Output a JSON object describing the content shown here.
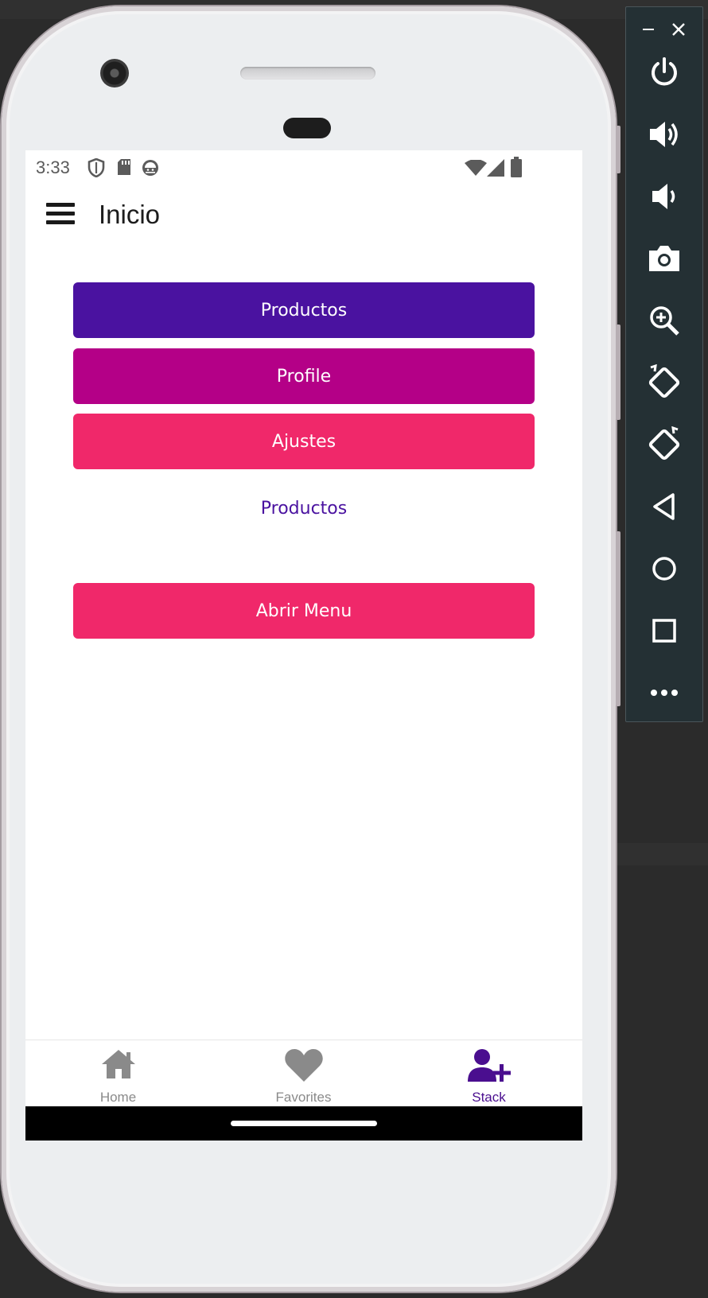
{
  "status_bar": {
    "time": "3:33"
  },
  "app_bar": {
    "title": "Inicio"
  },
  "buttons": {
    "productos": "Productos",
    "profile": "Profile",
    "ajustes": "Ajustes",
    "productos_link": "Productos",
    "abrir_menu": "Abrir Menu"
  },
  "tabs": [
    {
      "label": "Home",
      "icon": "home-icon",
      "active": false
    },
    {
      "label": "Favorites",
      "icon": "heart-icon",
      "active": false
    },
    {
      "label": "Stack",
      "icon": "user-plus-icon",
      "active": true
    }
  ],
  "colors": {
    "primary": "#4a12a0",
    "profile": "#b40087",
    "ajustes": "#f0286a",
    "abrir_menu": "#f0286a",
    "tab_active": "#4a0e8f",
    "tab_inactive": "#8a8a8a",
    "emulator_panel": "#243034"
  },
  "emulator_controls": [
    "minimize-icon",
    "close-icon",
    "power-icon",
    "volume-up-icon",
    "volume-down-icon",
    "camera-icon",
    "zoom-icon",
    "rotate-left-icon",
    "rotate-right-icon",
    "back-icon",
    "home-circle-icon",
    "overview-icon",
    "more-icon"
  ]
}
